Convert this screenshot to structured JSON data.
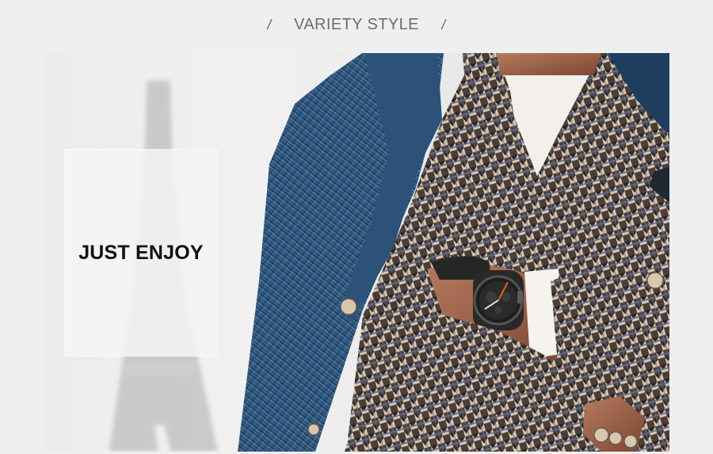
{
  "header": {
    "left_slash": "/",
    "title": "VARIETY STYLE",
    "right_slash": "/"
  },
  "hero": {
    "overlay_text": "JUST ENJOY",
    "background_color": "#ececec",
    "colors": {
      "coat_blue": "#355f89",
      "coat_shadow": "#203a55",
      "check_dark": "#3d3432",
      "check_light": "#d7c3a6",
      "shirt_white": "#f7f3ef",
      "skin": "#a66a4f",
      "watch_black": "#222222",
      "watch_orange": "#d35b21"
    }
  }
}
